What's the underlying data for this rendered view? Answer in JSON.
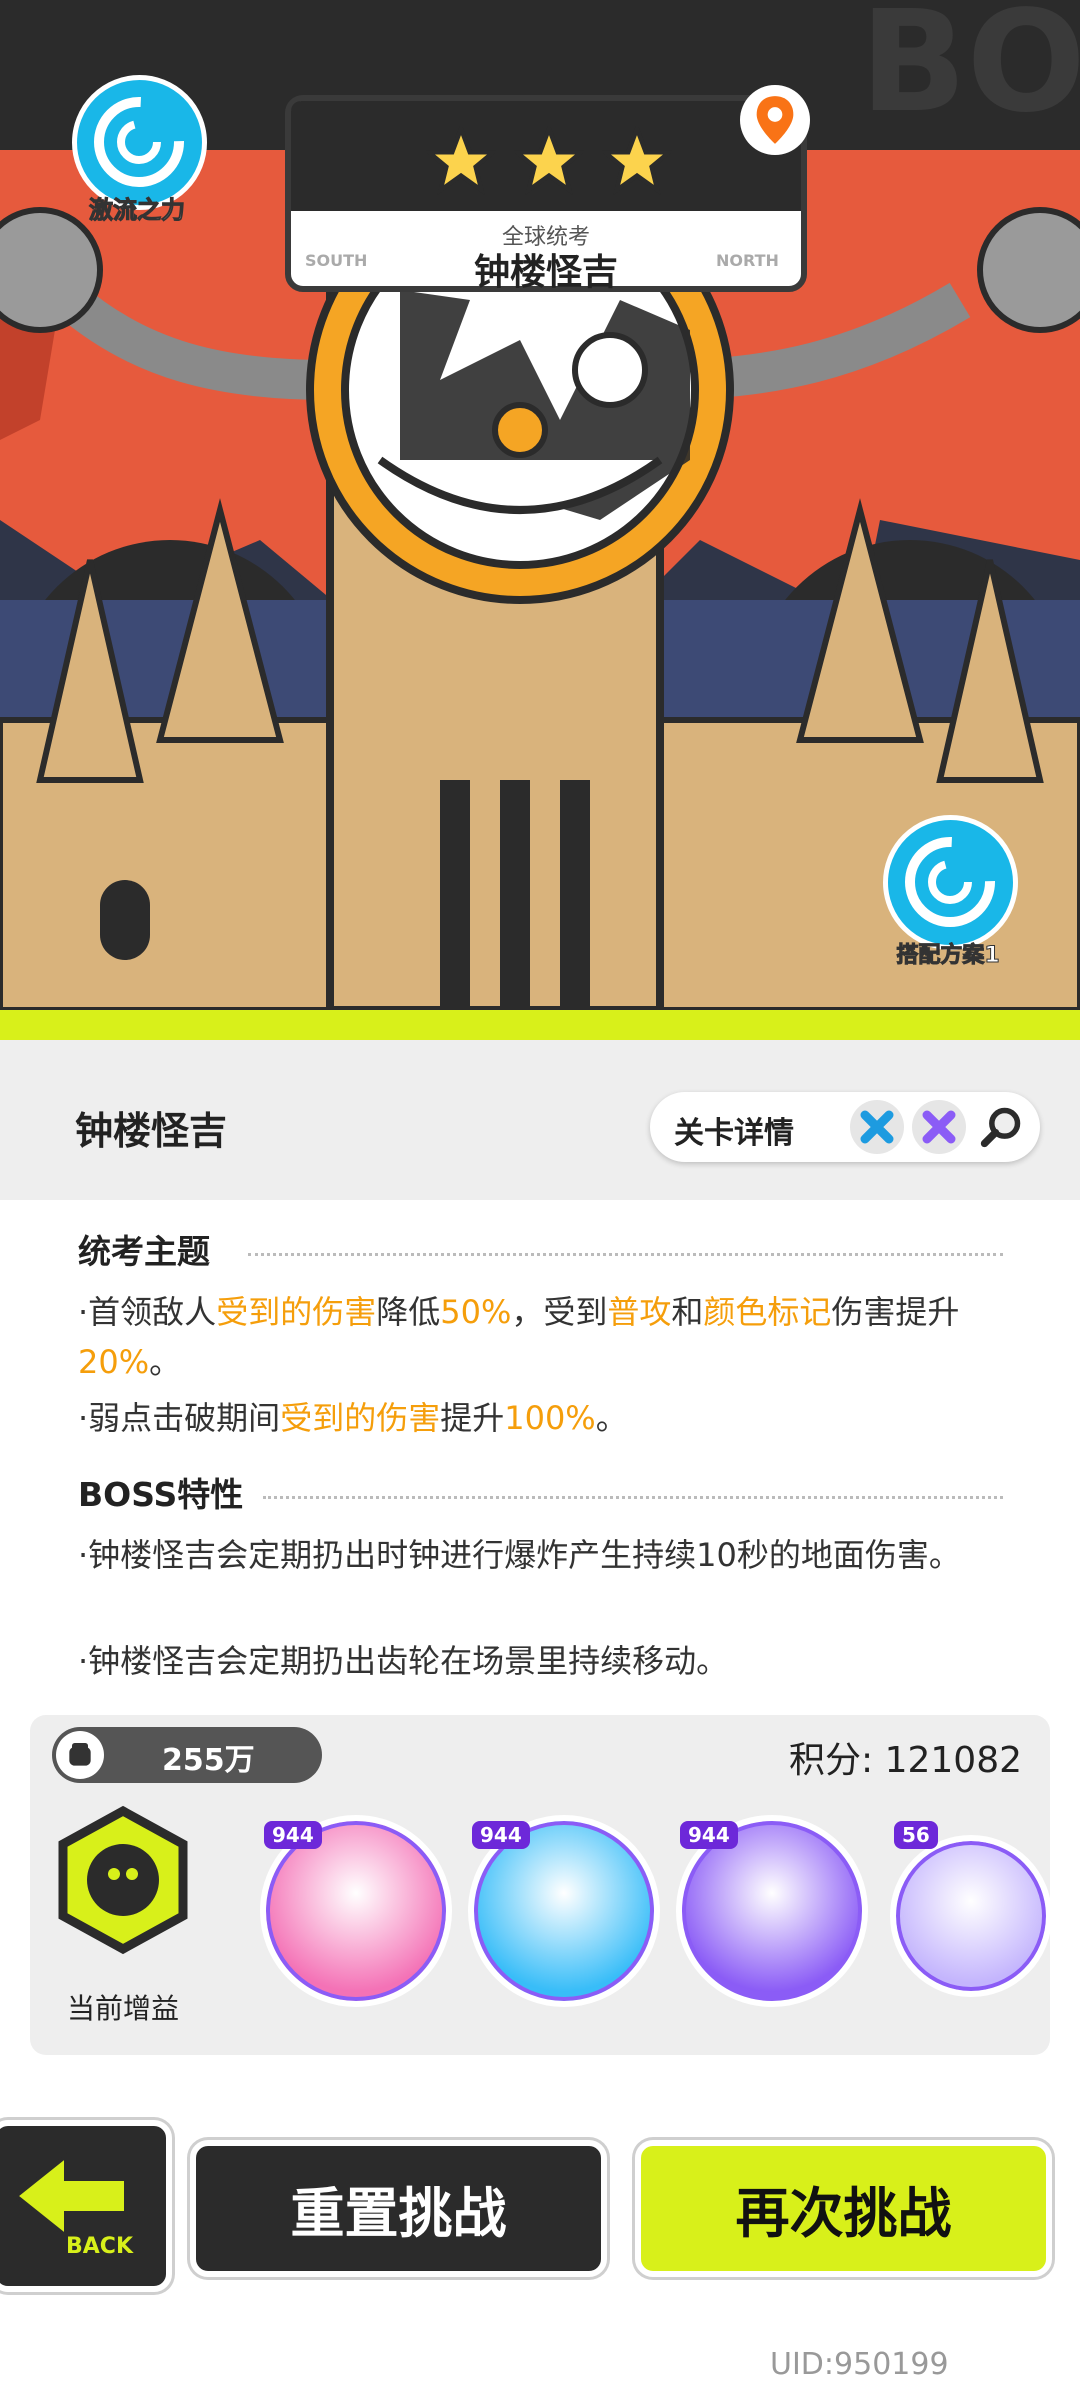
{
  "header": {
    "buff_badge_label": "激流之力",
    "stage_category": "全球统考",
    "stage_name": "钟楼怪吉",
    "dir_left": "SOUTH",
    "dir_right": "NORTH",
    "stars": 3,
    "loadout_label": "搭配方案1"
  },
  "panel": {
    "title": "钟楼怪吉",
    "details_label": "关卡详情"
  },
  "sections": {
    "theme_title": "统考主题",
    "theme_l1": [
      {
        "t": "·首领敌人"
      },
      {
        "t": "受到的伤害",
        "h": true
      },
      {
        "t": "降低"
      },
      {
        "t": "50%",
        "h": true
      },
      {
        "t": "，受到"
      },
      {
        "t": "普攻",
        "h": true
      },
      {
        "t": "和"
      },
      {
        "t": "颜色标记",
        "h": true
      },
      {
        "t": "伤害提升"
      },
      {
        "t": "20%",
        "h": true
      },
      {
        "t": "。"
      }
    ],
    "theme_l2": [
      {
        "t": "·弱点击破期间"
      },
      {
        "t": "受到的伤害",
        "h": true
      },
      {
        "t": "提升"
      },
      {
        "t": "100%",
        "h": true
      },
      {
        "t": "。"
      }
    ],
    "boss_title": "BOSS特性",
    "boss_l1": "·钟楼怪吉会定期扔出时钟进行爆炸产生持续10秒的地面伤害。",
    "boss_l2": "·钟楼怪吉会定期扔出齿轮在场景里持续移动。"
  },
  "score_card": {
    "power": "255万",
    "score_label": "积分: 121082",
    "buff_label": "当前增益",
    "heroes": [
      {
        "level": "944",
        "color": "#f472b6"
      },
      {
        "level": "944",
        "color": "#38bdf8"
      },
      {
        "level": "944",
        "color": "#8b5cf6"
      },
      {
        "level": "56",
        "color": "#c4b5fd"
      }
    ]
  },
  "buttons": {
    "back": "BACK",
    "reset": "重置挑战",
    "again": "再次挑战"
  },
  "footer": {
    "uid": "UID:950199"
  },
  "colors": {
    "accent_lime": "#d8f01a",
    "highlight": "#f59e0b",
    "dark": "#2b2b2b"
  }
}
